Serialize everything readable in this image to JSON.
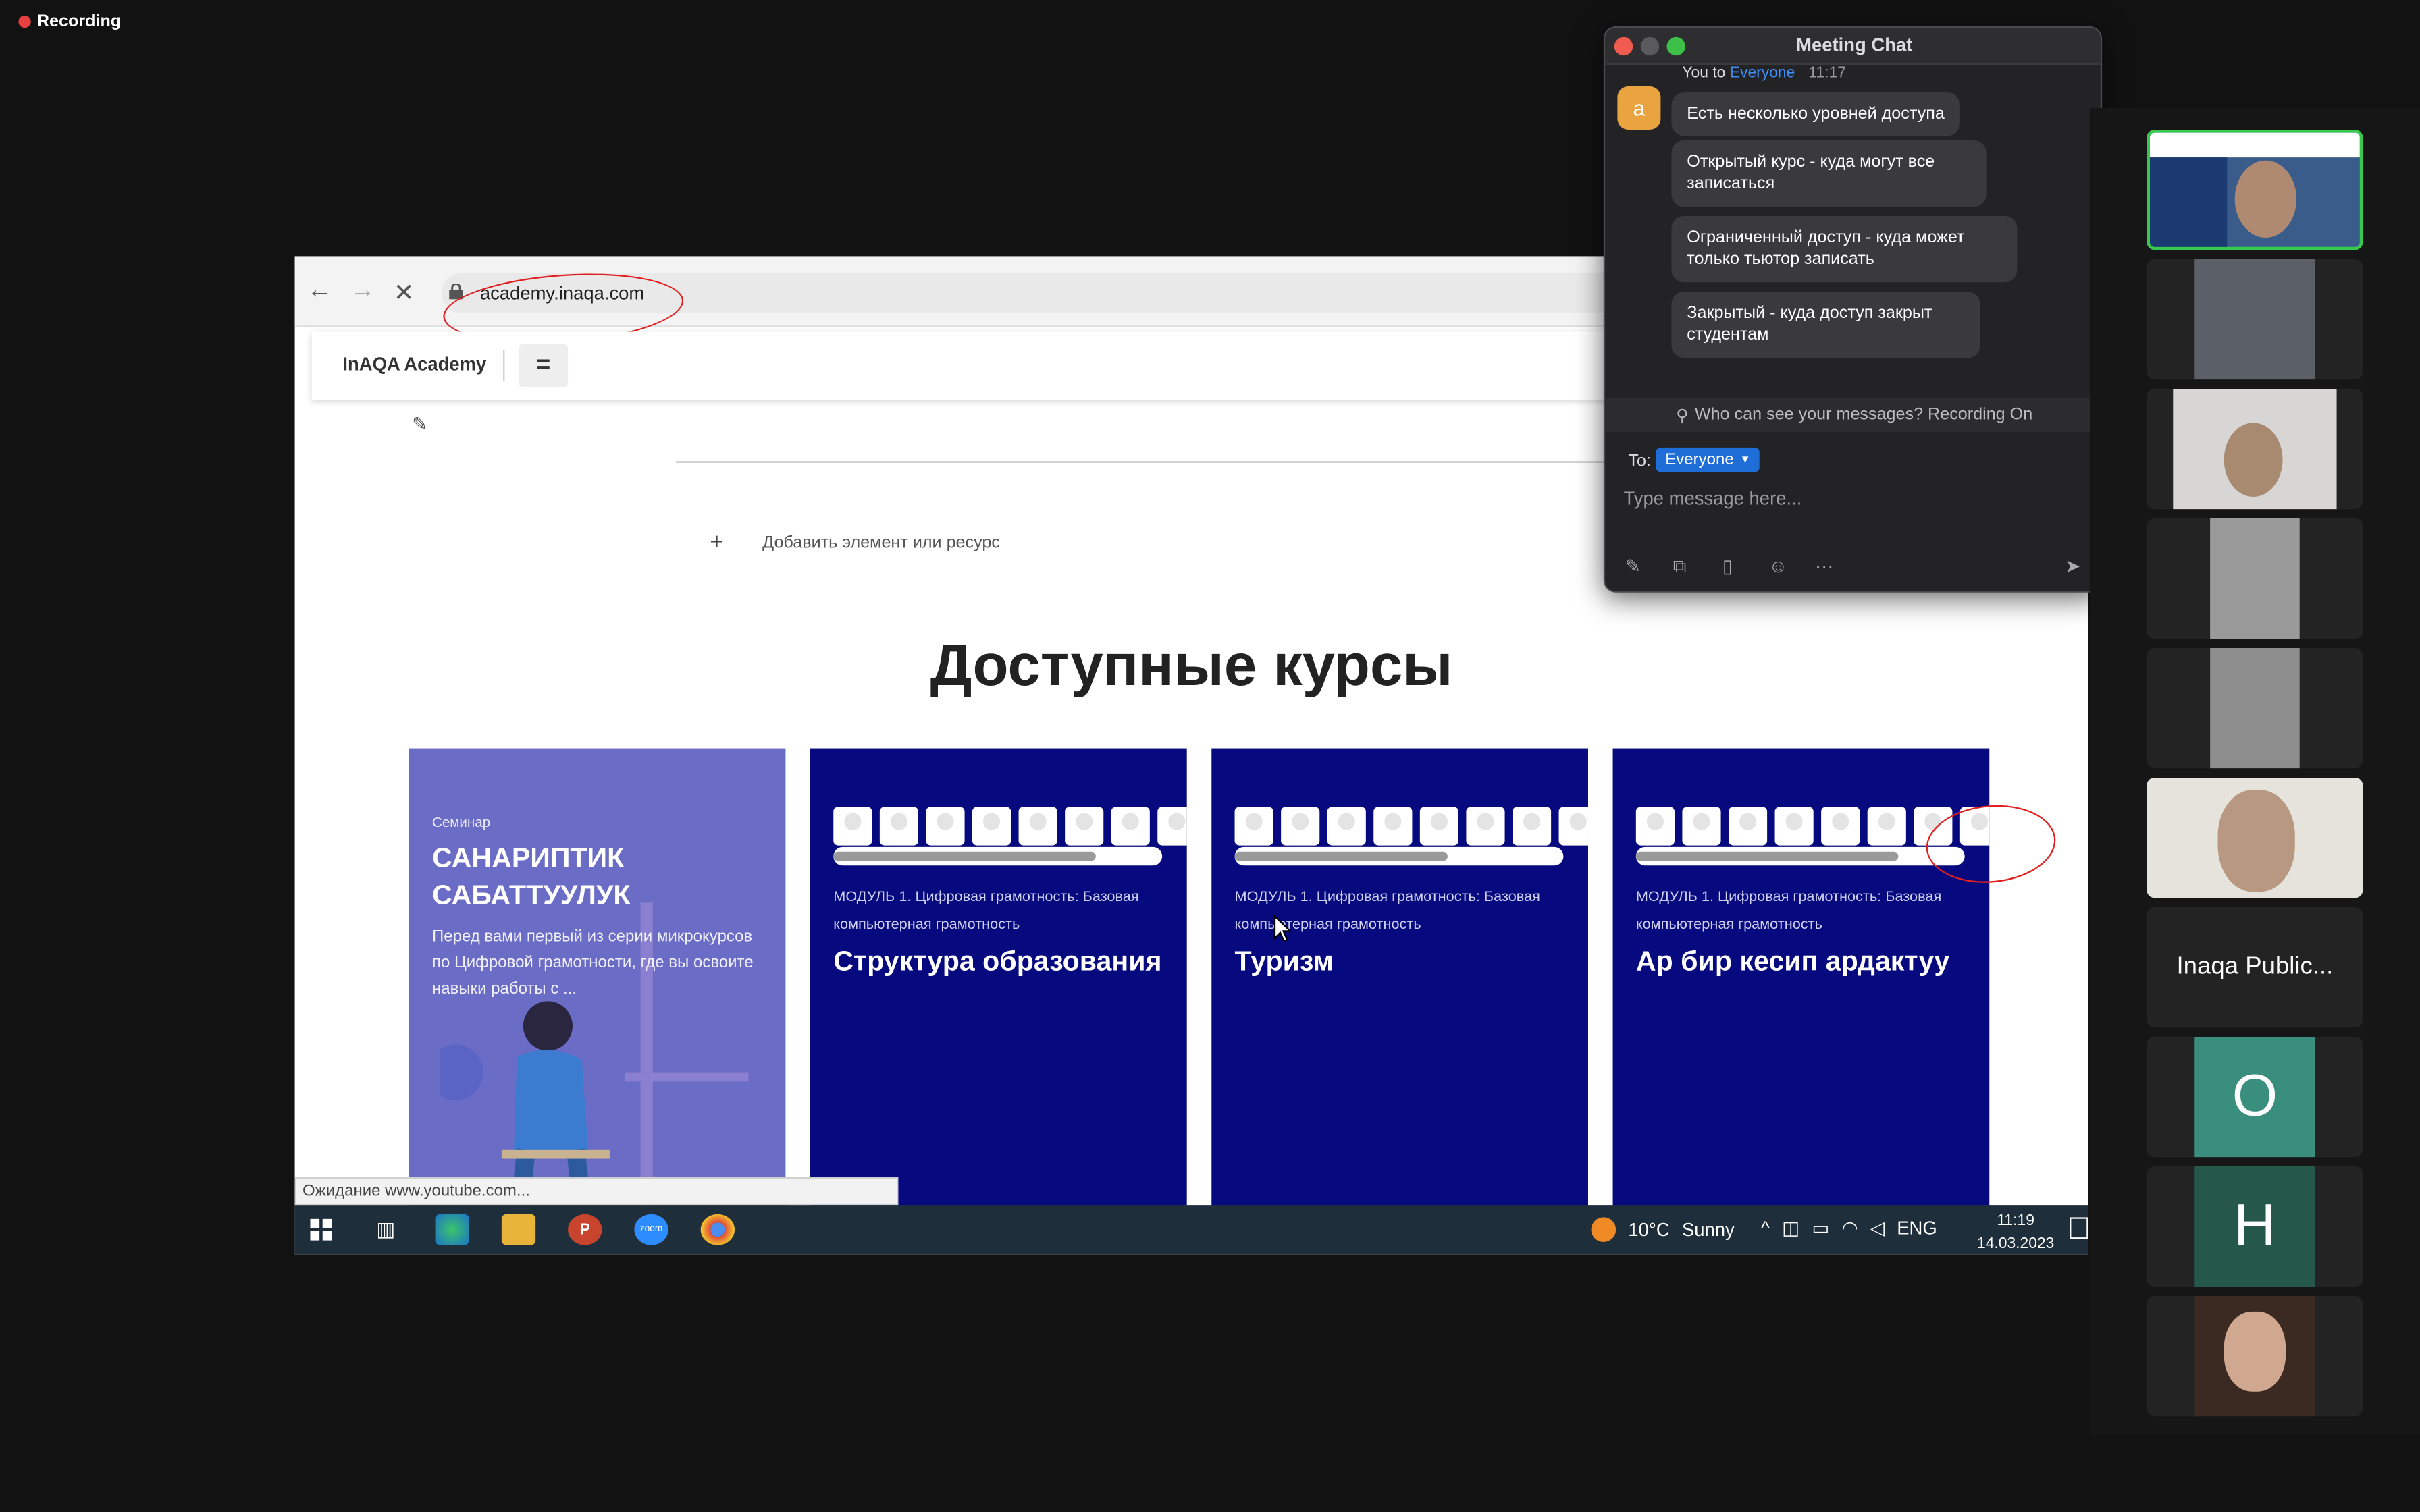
{
  "recording": {
    "label": "Recording"
  },
  "browser": {
    "url": "academy.inaqa.com",
    "status_url": "Ожидание www.youtube.com..."
  },
  "site": {
    "brand": "InAQA Academy",
    "menu_icon": "=",
    "add_item": "Добавить элемент или ресурс",
    "courses_title": "Доступные курсы",
    "cards": [
      {
        "kind": "Семинар",
        "title": "САНАРИПТИК САБАТТУУЛУК",
        "desc": "Перед вами первый из серии микрокурсов по Цифровой грамотности, где вы освоите навыки работы с ..."
      },
      {
        "module": "МОДУЛЬ 1. Цифровая грамотность: Базовая компьютерная грамотность",
        "title": "Структура образования",
        "progress": 0.8
      },
      {
        "module": "МОДУЛЬ 1. Цифровая грамотность: Базовая компьютерная грамотность",
        "title": "Туризм",
        "progress": 0.65
      },
      {
        "module": "МОДУЛЬ 1. Цифровая грамотность: Базовая компьютерная грамотность",
        "title": "Ар бир кесип ардактуу",
        "progress": 0.8
      }
    ]
  },
  "taskbar": {
    "weather_temp": "10°C",
    "weather_desc": "Sunny",
    "lang": "ENG",
    "time": "11:19",
    "date": "14.03.2023"
  },
  "chat": {
    "title": "Meeting Chat",
    "from": "You to",
    "to_who": "Everyone",
    "time": "11:17",
    "avatar_letter": "a",
    "messages": [
      "Есть несколько уровней доступа",
      "Открытый курс - куда могут все записаться",
      "Ограниченный доступ - куда может только тьютор записать",
      "Закрытый - куда доступ закрыт студентам"
    ],
    "visibility_notice": "Who can see your messages? Recording On",
    "to_label": "To:",
    "recipient": "Everyone",
    "placeholder": "Type message here..."
  },
  "participants": {
    "named_tile": "Inaqa Public...",
    "initials": [
      "O",
      "H"
    ],
    "colors": [
      "#3a8e7e",
      "#26584a"
    ]
  }
}
